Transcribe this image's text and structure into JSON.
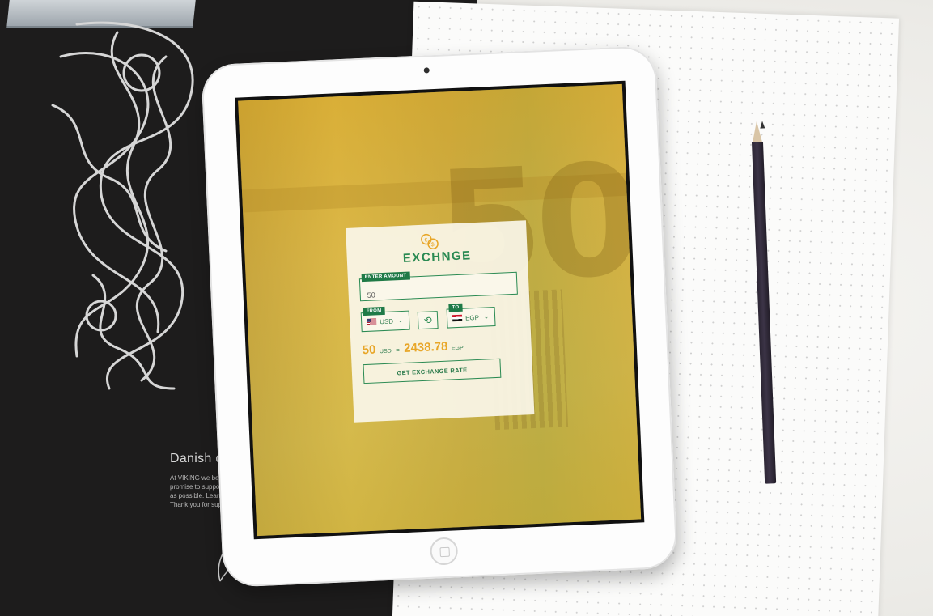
{
  "app": {
    "logo": "EXCHNGE",
    "amount_label": "ENTER AMOUNT",
    "amount_value": "50",
    "from_label": "FROM",
    "from_currency": "USD",
    "to_label": "TO",
    "to_currency": "EGP",
    "result": {
      "amount": "50",
      "amount_unit": "USD",
      "equals": "=",
      "total": "2438.78",
      "total_unit": "EGP"
    },
    "button_label": "GET EXCHANGE RATE"
  },
  "book": {
    "title": "Danish des",
    "lines": [
      "At VIKING we believe in q",
      "promise to support local",
      "as possible. Learn more at",
      "Thank you for supporting u"
    ]
  },
  "icons": {
    "coin": "coins-icon",
    "swap": "swap-icon",
    "chevron": "chevron-down-icon",
    "flag_from": "us-flag-icon",
    "flag_to": "egypt-flag-icon"
  },
  "colors": {
    "brand_green": "#2a8a52",
    "accent_orange": "#e8a628",
    "card_bg": "#faf6e8"
  }
}
